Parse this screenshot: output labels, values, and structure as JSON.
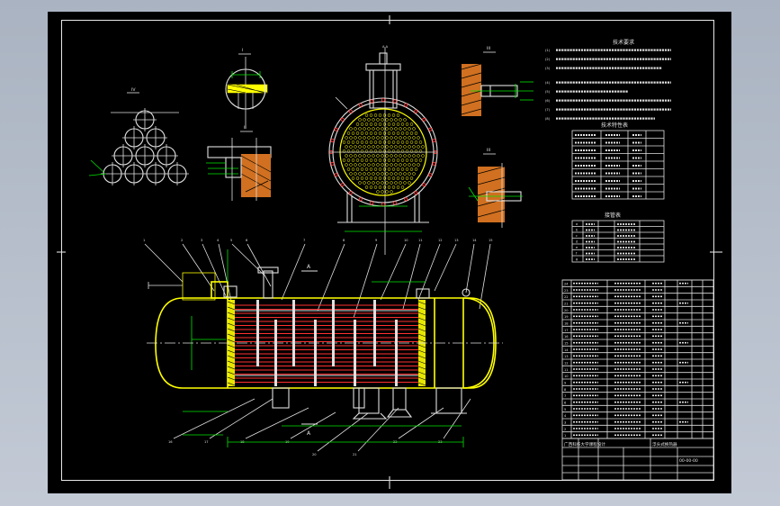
{
  "drawing": {
    "section_labels": {
      "view_iv": "IV",
      "view_i": "I",
      "view_ii": "II",
      "view_iii": "III",
      "view_a": "A",
      "view_b": "A"
    },
    "part_numbers_top": [
      "1",
      "2",
      "3",
      "4",
      "5",
      "6",
      "7",
      "8",
      "9",
      "10",
      "11",
      "12",
      "13",
      "14",
      "15"
    ],
    "part_numbers_bottom": [
      "16",
      "17",
      "18",
      "19",
      "20",
      "21",
      "22",
      "23"
    ],
    "colors": {
      "background": "#000000",
      "line": "#e0e0e0",
      "shell": "#ffff00",
      "dimension": "#00e600",
      "tube": "#ff3030",
      "viewport_border": "#aab3c1"
    }
  },
  "tables": {
    "technical_req_title": "技术要求",
    "technical_req_lines": [
      "(1)",
      "(2)",
      "(3)",
      "(4)",
      "(5)",
      "(6)",
      "(7)",
      "(8)"
    ],
    "tech_char_title": "技术特性表",
    "nozzle_title": "接管表",
    "nozzle_rows": [
      "a",
      "b",
      "c",
      "d",
      "e",
      "f",
      "g"
    ]
  },
  "title_block": {
    "school": "广西科技大学课程设计",
    "drawing_title": "浮头式换热器",
    "drawing_no": "00-00-00"
  },
  "parts_list": {
    "row_ids": [
      "24",
      "23",
      "22",
      "21",
      "20",
      "19",
      "18",
      "17",
      "16",
      "15",
      "14",
      "13",
      "12",
      "11",
      "10",
      "9",
      "8",
      "7",
      "6",
      "5",
      "4",
      "3",
      "2",
      "1"
    ]
  }
}
